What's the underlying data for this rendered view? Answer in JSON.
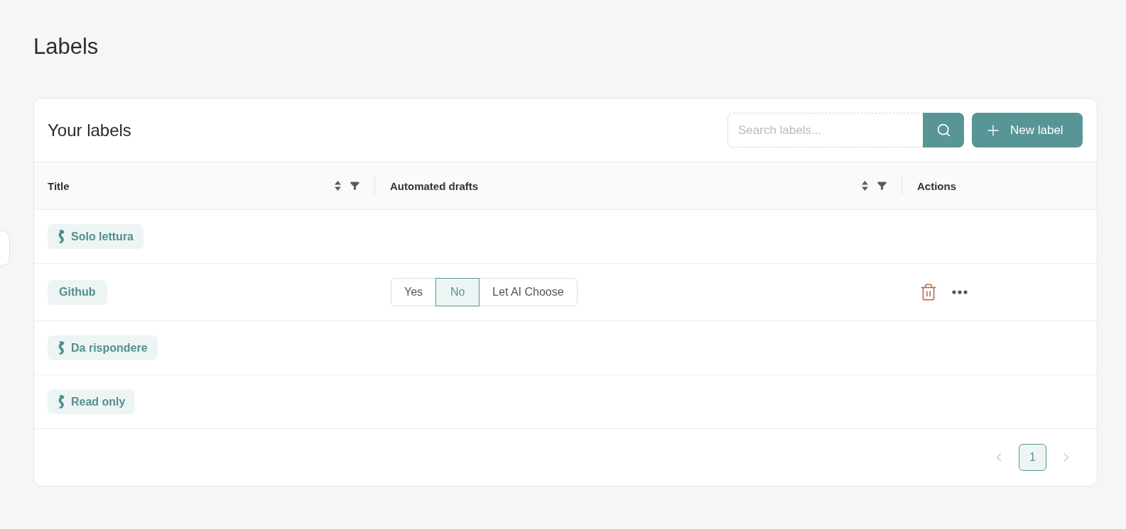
{
  "page": {
    "title": "Labels"
  },
  "card": {
    "title": "Your labels",
    "search": {
      "placeholder": "Search labels..."
    },
    "new_button": {
      "label": "New label"
    }
  },
  "table": {
    "columns": [
      {
        "label": "Title",
        "sortable": true,
        "filterable": true
      },
      {
        "label": "Automated drafts",
        "sortable": true,
        "filterable": true
      },
      {
        "label": "Actions",
        "sortable": false,
        "filterable": false
      }
    ],
    "rows": [
      {
        "title": "Solo lettura",
        "kind": "system"
      },
      {
        "title": "Github",
        "kind": "custom",
        "automated_drafts": [
          {
            "label": "Yes",
            "selected": false
          },
          {
            "label": "No",
            "selected": true
          },
          {
            "label": "Let AI Choose",
            "selected": false
          }
        ],
        "actions": [
          {
            "kind": "delete"
          },
          {
            "kind": "more"
          }
        ]
      },
      {
        "title": "Da rispondere",
        "kind": "system"
      },
      {
        "title": "Read only",
        "kind": "system"
      }
    ]
  },
  "pagination": {
    "previous": {
      "disabled": true
    },
    "pages": [
      {
        "label": "1",
        "selected": true
      }
    ],
    "next": {
      "disabled": true
    }
  }
}
